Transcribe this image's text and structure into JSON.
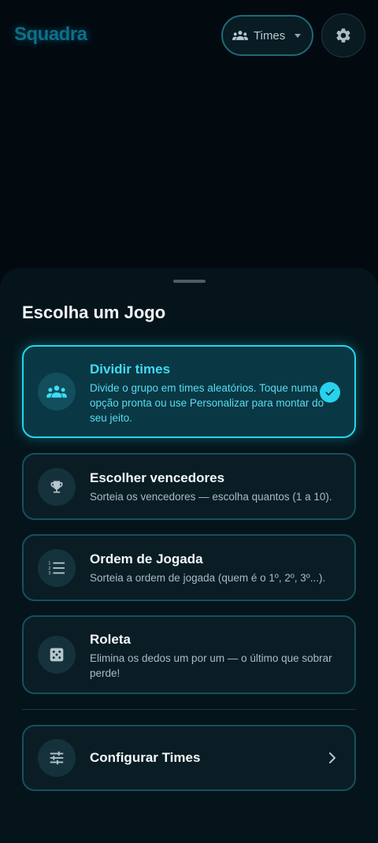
{
  "app": {
    "logo_text": "Squadra"
  },
  "header": {
    "mode_selector": {
      "label": "Times",
      "icon": "groups-icon"
    },
    "settings": {
      "icon": "gear-icon"
    }
  },
  "sheet": {
    "title": "Escolha um Jogo",
    "options": [
      {
        "title": "Dividir times",
        "description": "Divide o grupo em times aleatórios. Toque numa opção pronta ou use Personalizar para montar do seu jeito.",
        "icon": "groups-icon",
        "selected": true
      },
      {
        "title": "Escolher vencedores",
        "description": "Sorteia os vencedores — escolha quantos (1 a 10).",
        "icon": "trophy-icon",
        "selected": false
      },
      {
        "title": "Ordem de Jogada",
        "description": "Sorteia a ordem de jogada (quem é o 1º, 2º, 3º...).",
        "icon": "numbered-list-icon",
        "selected": false
      },
      {
        "title": "Roleta",
        "description": "Elimina os dedos um por um — o último que sobrar perde!",
        "icon": "dice-icon",
        "selected": false
      }
    ],
    "configure": {
      "label": "Configurar Times",
      "icon": "tune-icon"
    }
  },
  "colors": {
    "accent": "#1fd7f0",
    "background": "#020a10",
    "sheet": "#05141b",
    "card_border": "#15505d"
  }
}
